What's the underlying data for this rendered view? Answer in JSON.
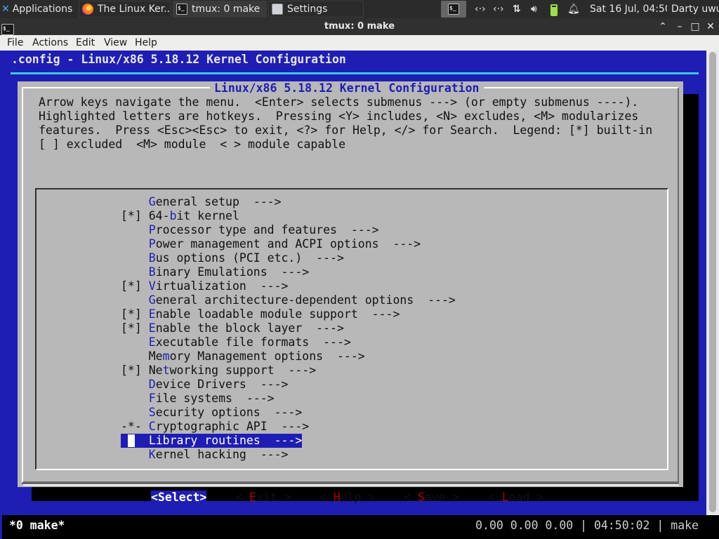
{
  "panel": {
    "applications_label": "Applications",
    "tasks": [
      {
        "label": "The Linux Ker...",
        "icon": "firefox-icon"
      },
      {
        "label": "tmux: 0 make",
        "icon": "terminal-icon"
      },
      {
        "label": "Settings",
        "icon": "settings-icon"
      }
    ],
    "clock": "Sat 16 Jul, 04:50",
    "user": "Darty uwu"
  },
  "window": {
    "title": "tmux: 0 make",
    "controls": {
      "minimize": "^",
      "maximize": "–",
      "restore": "□",
      "close": "✕"
    }
  },
  "menubar": {
    "items": [
      "File",
      "Actions",
      "Edit",
      "View",
      "Help"
    ]
  },
  "terminal": {
    "header": ".config - Linux/x86 5.18.12 Kernel Configuration",
    "dialog_title": "Linux/x86 5.18.12 Kernel Configuration",
    "help_lines": [
      "Arrow keys navigate the menu.  <Enter> selects submenus ---> (or empty submenus ----).",
      "Highlighted letters are hotkeys.  Pressing <Y> includes, <N> excludes, <M> modularizes",
      "features.  Press <Esc><Esc> to exit, <?> for Help, </> for Search.  Legend: [*] built-in",
      "[ ] excluded  <M> module  < > module capable"
    ],
    "menu_items": [
      {
        "prefix": "    ",
        "hk": "G",
        "rest": "eneral setup  --->"
      },
      {
        "prefix": "[*] ",
        "pre": "64-",
        "hk": "b",
        "rest": "it kernel"
      },
      {
        "prefix": "    ",
        "hk": "P",
        "rest": "rocessor type and features  --->"
      },
      {
        "prefix": "    ",
        "hk": "P",
        "rest": "ower management and ACPI options  --->"
      },
      {
        "prefix": "    ",
        "hk": "B",
        "rest": "us options (PCI etc.)  --->"
      },
      {
        "prefix": "    ",
        "hk": "B",
        "rest": "inary Emulations  --->"
      },
      {
        "prefix": "[*] ",
        "hk": "V",
        "rest": "irtualization  --->"
      },
      {
        "prefix": "    ",
        "hk": "G",
        "rest": "eneral architecture-dependent options  --->"
      },
      {
        "prefix": "[*] ",
        "hk": "E",
        "rest": "nable loadable module support  --->"
      },
      {
        "prefix": "[*] ",
        "hk": "E",
        "rest": "nable the block layer  --->"
      },
      {
        "prefix": "    ",
        "hk": "E",
        "rest": "xecutable file formats  --->"
      },
      {
        "prefix": "    ",
        "pre": "Me",
        "hk": "m",
        "rest": "ory Management options  --->"
      },
      {
        "prefix": "[*] ",
        "pre": "Ne",
        "hk": "t",
        "rest": "working support  --->"
      },
      {
        "prefix": "    ",
        "hk": "D",
        "rest": "evice Drivers  --->"
      },
      {
        "prefix": "    ",
        "hk": "F",
        "rest": "ile systems  --->"
      },
      {
        "prefix": "    ",
        "hk": "S",
        "rest": "ecurity options  --->"
      },
      {
        "prefix": "-*- ",
        "hk": "C",
        "rest": "ryptographic API  --->"
      },
      {
        "prefix": "    ",
        "hk": "",
        "rest": "Library routines  --->",
        "selected": true
      },
      {
        "prefix": "    ",
        "hk": "K",
        "rest": "ernel hacking  --->"
      }
    ],
    "buttons": [
      {
        "label": "<Select>",
        "selected": true
      },
      {
        "open": "< ",
        "hk": "E",
        "rest": "xit",
        "close": " >"
      },
      {
        "open": "< ",
        "hk": "H",
        "rest": "elp",
        "close": " >"
      },
      {
        "open": "< ",
        "hk": "S",
        "rest": "ave",
        "close": " >"
      },
      {
        "open": "< ",
        "hk": "L",
        "rest": "oad",
        "close": " >"
      }
    ],
    "status_left": "*0 make*",
    "status_right": "0.00 0.00 0.00 | 04:50:02 | make"
  },
  "colors": {
    "terminal_bg": "#1e1eb4",
    "dialog_bg": "#b8b8b8",
    "hotkey_menu": "#1e1eb4",
    "hotkey_button": "#b00000",
    "rule": "#3cc8e8"
  }
}
